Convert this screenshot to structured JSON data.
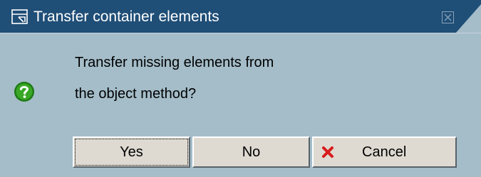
{
  "dialog": {
    "title": "Transfer container elements",
    "message_line1": "Transfer missing elements from",
    "message_line2": "the object method?",
    "buttons": {
      "yes": "Yes",
      "no": "No",
      "cancel": "Cancel"
    }
  },
  "icons": {
    "title": "dialog-window-icon",
    "close": "close-icon",
    "question": "help-icon",
    "cancel": "red-x-icon"
  },
  "colors": {
    "titlebar": "#1f4e77",
    "dialog_background": "#a4bdc9",
    "button_face": "#dedad2"
  }
}
